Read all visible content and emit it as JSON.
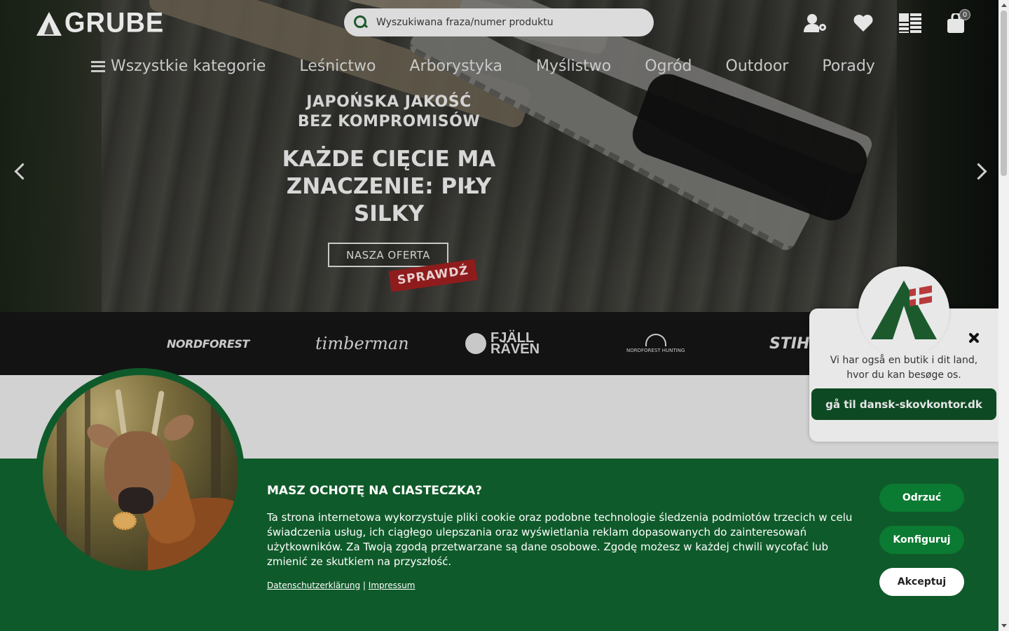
{
  "header": {
    "logo_text": "GRUBE",
    "search_placeholder": "Wyszukiwana fraza/numer produktu",
    "icons": [
      "user-settings-icon",
      "heart-icon",
      "catalog-icon",
      "bag-icon"
    ],
    "cart_count": "0"
  },
  "nav": {
    "all_categories": "Wszystkie kategorie",
    "items": [
      "Leśnictwo",
      "Arborystyka",
      "Myślistwo",
      "Ogród",
      "Outdoor",
      "Porady"
    ]
  },
  "hero": {
    "subtitle_line1": "JAPOŃSKA JAKOŚĆ",
    "subtitle_line2": "BEZ KOMPROMISÓW",
    "title": "KAŻDE CIĘCIE MA ZNACZENIE: PIŁY SILKY",
    "button": "NASZA OFERTA",
    "stamp": "SPRAWDŹ"
  },
  "brands": {
    "b1": "NORDFOREST",
    "b2": "timberman",
    "b3_line1": "FJÄLL",
    "b3_line2": "RÄVEN",
    "b4": "NORDFOREST HUNTING",
    "b5": "STIHL"
  },
  "dk_popup": {
    "text": "Vi har også en butik i dit land, hvor du kan besøge os.",
    "button": "gå til dansk-skovkontor.dk"
  },
  "cookie": {
    "title": "MASZ OCHOTĘ NA CIASTECZKA?",
    "text": "Ta strona internetowa wykorzystuje pliki cookie oraz podobne technologie śledzenia podmiotów trzecich w celu świadczenia usług, ich ciągłego ulepszania oraz wyświetlania reklam dopasowanych do zainteresowań użytkowników. Za Twoją zgodą przetwarzane są dane osobowe. Zgodę możesz w każdej chwili wycofać lub zmienić ze skutkiem na przyszłość.",
    "link_privacy": "Datenschutzerklärung",
    "separator": "|",
    "link_imprint": "Impressum",
    "btn_reject": "Odrzuć",
    "btn_configure": "Konfiguruj",
    "btn_accept": "Akceptuj"
  },
  "colors": {
    "brand_green": "#0f5a2a",
    "button_green": "#0b7a32",
    "dk_button": "#0d4a23"
  }
}
